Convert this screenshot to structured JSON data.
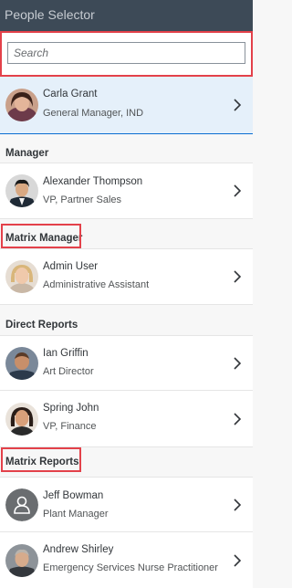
{
  "header": {
    "title": "People Selector"
  },
  "search": {
    "placeholder": "Search"
  },
  "selected": {
    "name": "Carla Grant",
    "title": "General Manager, IND"
  },
  "sections": {
    "manager": "Manager",
    "matrix_manager": "Matrix Manager",
    "direct_reports": "Direct Reports",
    "matrix_reports": "Matrix Reports"
  },
  "people": {
    "alexander": {
      "name": "Alexander Thompson",
      "title": "VP, Partner Sales"
    },
    "admin": {
      "name": "Admin User",
      "title": "Administrative Assistant"
    },
    "ian": {
      "name": "Ian Griffin",
      "title": "Art Director"
    },
    "spring": {
      "name": "Spring John",
      "title": "VP, Finance"
    },
    "jeff": {
      "name": "Jeff Bowman",
      "title": "Plant Manager"
    },
    "andrew": {
      "name": "Andrew Shirley",
      "title": "Emergency Services Nurse Practitioner"
    }
  },
  "colors": {
    "header_bg": "#3d4a57",
    "selected_bg": "#e5f0fa",
    "highlight": "#e3414a",
    "accent": "#0a6ed1"
  },
  "icons": {
    "chevron": "chevron-right-icon",
    "placeholder_avatar": "person-placeholder-icon"
  }
}
